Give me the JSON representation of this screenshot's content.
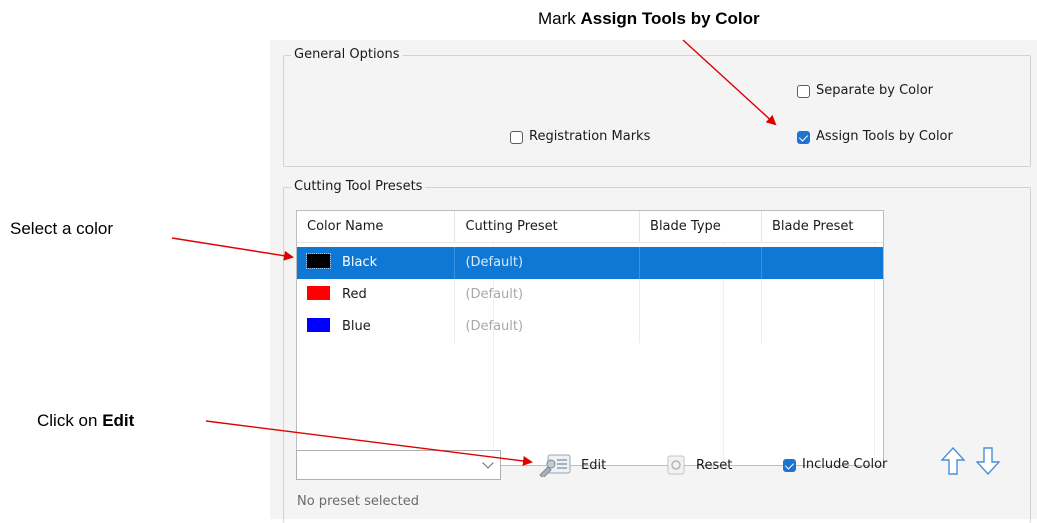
{
  "annotations": {
    "mark_prefix": "Mark ",
    "mark_bold": "Assign Tools by Color",
    "select_color": "Select a color",
    "click_prefix": "Click on ",
    "click_bold": "Edit"
  },
  "general_options": {
    "title": "General Options",
    "separate_by_color": {
      "label": "Separate by Color",
      "checked": false
    },
    "registration_marks": {
      "label": "Registration Marks",
      "checked": false
    },
    "assign_tools_by_color": {
      "label": "Assign Tools by Color",
      "checked": true
    }
  },
  "cutting_tool_presets": {
    "title": "Cutting Tool Presets",
    "columns": [
      "Color Name",
      "Cutting Preset",
      "Blade Type",
      "Blade Preset"
    ],
    "rows": [
      {
        "color_name": "Black",
        "swatch": "#000000",
        "cutting_preset": "(Default)",
        "blade_type": "",
        "blade_preset": "",
        "selected": true
      },
      {
        "color_name": "Red",
        "swatch": "#ff0000",
        "cutting_preset": "(Default)",
        "blade_type": "",
        "blade_preset": "",
        "selected": false
      },
      {
        "color_name": "Blue",
        "swatch": "#0000ff",
        "cutting_preset": "(Default)",
        "blade_type": "",
        "blade_preset": "",
        "selected": false
      }
    ]
  },
  "toolbar": {
    "preset_combo_value": "",
    "edit_label": "Edit",
    "reset_label": "Reset",
    "include_color": {
      "label": "Include Color",
      "checked": true
    },
    "move_up_icon": "arrow-up-icon",
    "move_down_icon": "arrow-down-icon"
  },
  "status_text": "No preset selected",
  "colors": {
    "selection": "#0e78d4",
    "checkbox_checked": "#1e74d2",
    "annotation_arrow": "#e00000",
    "arrow_icon": "#4a8fd8"
  }
}
